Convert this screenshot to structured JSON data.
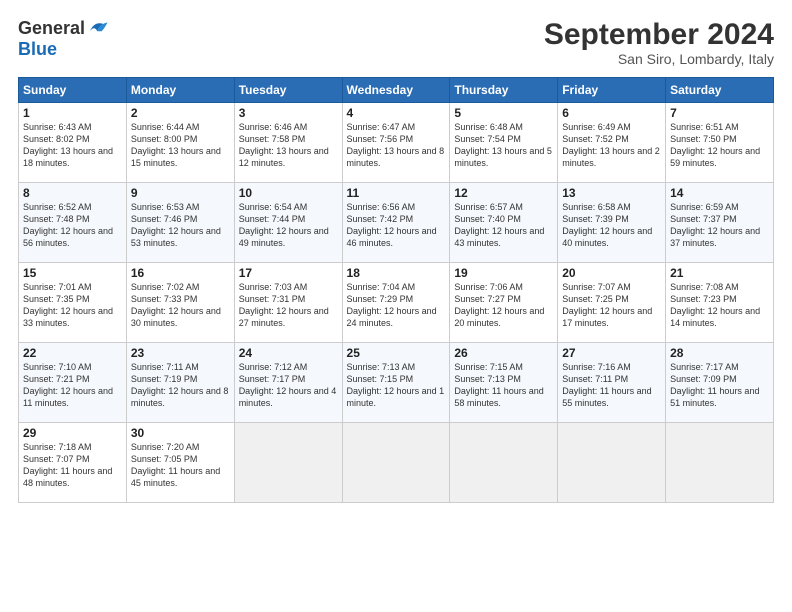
{
  "header": {
    "logo_line1": "General",
    "logo_line2": "Blue",
    "month_title": "September 2024",
    "location": "San Siro, Lombardy, Italy"
  },
  "weekdays": [
    "Sunday",
    "Monday",
    "Tuesday",
    "Wednesday",
    "Thursday",
    "Friday",
    "Saturday"
  ],
  "weeks": [
    [
      {
        "day": 1,
        "sunrise": "6:43 AM",
        "sunset": "8:02 PM",
        "daylight": "13 hours and 18 minutes."
      },
      {
        "day": 2,
        "sunrise": "6:44 AM",
        "sunset": "8:00 PM",
        "daylight": "13 hours and 15 minutes."
      },
      {
        "day": 3,
        "sunrise": "6:46 AM",
        "sunset": "7:58 PM",
        "daylight": "13 hours and 12 minutes."
      },
      {
        "day": 4,
        "sunrise": "6:47 AM",
        "sunset": "7:56 PM",
        "daylight": "13 hours and 8 minutes."
      },
      {
        "day": 5,
        "sunrise": "6:48 AM",
        "sunset": "7:54 PM",
        "daylight": "13 hours and 5 minutes."
      },
      {
        "day": 6,
        "sunrise": "6:49 AM",
        "sunset": "7:52 PM",
        "daylight": "13 hours and 2 minutes."
      },
      {
        "day": 7,
        "sunrise": "6:51 AM",
        "sunset": "7:50 PM",
        "daylight": "12 hours and 59 minutes."
      }
    ],
    [
      {
        "day": 8,
        "sunrise": "6:52 AM",
        "sunset": "7:48 PM",
        "daylight": "12 hours and 56 minutes."
      },
      {
        "day": 9,
        "sunrise": "6:53 AM",
        "sunset": "7:46 PM",
        "daylight": "12 hours and 53 minutes."
      },
      {
        "day": 10,
        "sunrise": "6:54 AM",
        "sunset": "7:44 PM",
        "daylight": "12 hours and 49 minutes."
      },
      {
        "day": 11,
        "sunrise": "6:56 AM",
        "sunset": "7:42 PM",
        "daylight": "12 hours and 46 minutes."
      },
      {
        "day": 12,
        "sunrise": "6:57 AM",
        "sunset": "7:40 PM",
        "daylight": "12 hours and 43 minutes."
      },
      {
        "day": 13,
        "sunrise": "6:58 AM",
        "sunset": "7:39 PM",
        "daylight": "12 hours and 40 minutes."
      },
      {
        "day": 14,
        "sunrise": "6:59 AM",
        "sunset": "7:37 PM",
        "daylight": "12 hours and 37 minutes."
      }
    ],
    [
      {
        "day": 15,
        "sunrise": "7:01 AM",
        "sunset": "7:35 PM",
        "daylight": "12 hours and 33 minutes."
      },
      {
        "day": 16,
        "sunrise": "7:02 AM",
        "sunset": "7:33 PM",
        "daylight": "12 hours and 30 minutes."
      },
      {
        "day": 17,
        "sunrise": "7:03 AM",
        "sunset": "7:31 PM",
        "daylight": "12 hours and 27 minutes."
      },
      {
        "day": 18,
        "sunrise": "7:04 AM",
        "sunset": "7:29 PM",
        "daylight": "12 hours and 24 minutes."
      },
      {
        "day": 19,
        "sunrise": "7:06 AM",
        "sunset": "7:27 PM",
        "daylight": "12 hours and 20 minutes."
      },
      {
        "day": 20,
        "sunrise": "7:07 AM",
        "sunset": "7:25 PM",
        "daylight": "12 hours and 17 minutes."
      },
      {
        "day": 21,
        "sunrise": "7:08 AM",
        "sunset": "7:23 PM",
        "daylight": "12 hours and 14 minutes."
      }
    ],
    [
      {
        "day": 22,
        "sunrise": "7:10 AM",
        "sunset": "7:21 PM",
        "daylight": "12 hours and 11 minutes."
      },
      {
        "day": 23,
        "sunrise": "7:11 AM",
        "sunset": "7:19 PM",
        "daylight": "12 hours and 8 minutes."
      },
      {
        "day": 24,
        "sunrise": "7:12 AM",
        "sunset": "7:17 PM",
        "daylight": "12 hours and 4 minutes."
      },
      {
        "day": 25,
        "sunrise": "7:13 AM",
        "sunset": "7:15 PM",
        "daylight": "12 hours and 1 minute."
      },
      {
        "day": 26,
        "sunrise": "7:15 AM",
        "sunset": "7:13 PM",
        "daylight": "11 hours and 58 minutes."
      },
      {
        "day": 27,
        "sunrise": "7:16 AM",
        "sunset": "7:11 PM",
        "daylight": "11 hours and 55 minutes."
      },
      {
        "day": 28,
        "sunrise": "7:17 AM",
        "sunset": "7:09 PM",
        "daylight": "11 hours and 51 minutes."
      }
    ],
    [
      {
        "day": 29,
        "sunrise": "7:18 AM",
        "sunset": "7:07 PM",
        "daylight": "11 hours and 48 minutes."
      },
      {
        "day": 30,
        "sunrise": "7:20 AM",
        "sunset": "7:05 PM",
        "daylight": "11 hours and 45 minutes."
      },
      null,
      null,
      null,
      null,
      null
    ]
  ]
}
